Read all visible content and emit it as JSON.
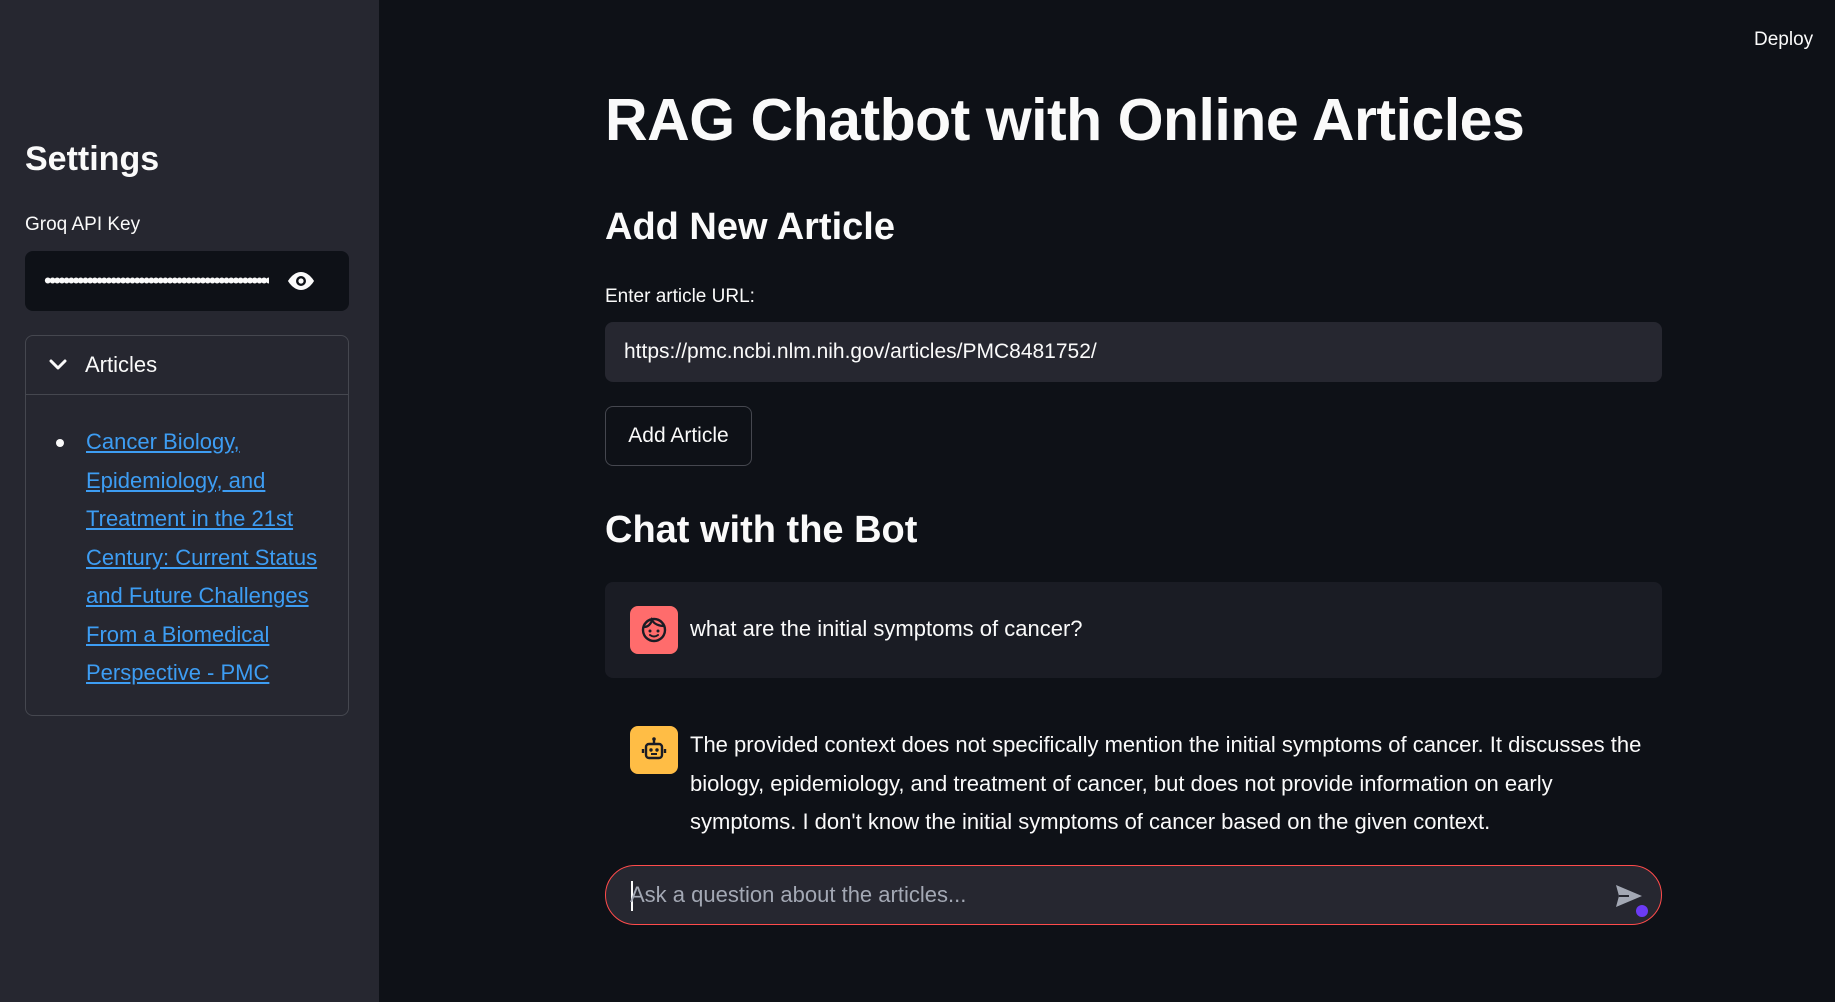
{
  "header": {
    "deploy_label": "Deploy"
  },
  "sidebar": {
    "title": "Settings",
    "api_key": {
      "label": "Groq API Key",
      "masked_value": "••••••••••••••••••••••••••••••••••••••••••••••••••••••",
      "toggle_icon": "eye-icon"
    },
    "articles": {
      "title": "Articles",
      "expanded": true,
      "items": [
        {
          "title": "Cancer Biology, Epidemiology, and Treatment in the 21st Century: Current Status and Future Challenges From a Biomedical Perspective - PMC"
        }
      ]
    }
  },
  "main": {
    "title": "RAG Chatbot with Online Articles",
    "add_article": {
      "heading": "Add New Article",
      "url_label": "Enter article URL:",
      "url_value": "https://pmc.ncbi.nlm.nih.gov/articles/PMC8481752/",
      "button_label": "Add Article"
    },
    "chat": {
      "heading": "Chat with the Bot",
      "messages": [
        {
          "role": "user",
          "avatar_icon": "user-face-icon",
          "text": "what are the initial symptoms of cancer?"
        },
        {
          "role": "assistant",
          "avatar_icon": "robot-icon",
          "text": "The provided context does not specifically mention the initial symptoms of cancer. It discusses the biology, epidemiology, and treatment of cancer, but does not provide information on early symptoms. I don't know the initial symptoms of cancer based on the given context."
        }
      ],
      "input_placeholder": "Ask a question about the articles...",
      "send_icon": "send-icon"
    }
  },
  "colors": {
    "background": "#0e1117",
    "sidebar": "#262730",
    "link": "#3d9df3",
    "user_avatar": "#ff6c6c",
    "bot_avatar": "#ffbd45",
    "focus_border": "#ff4b4b"
  }
}
